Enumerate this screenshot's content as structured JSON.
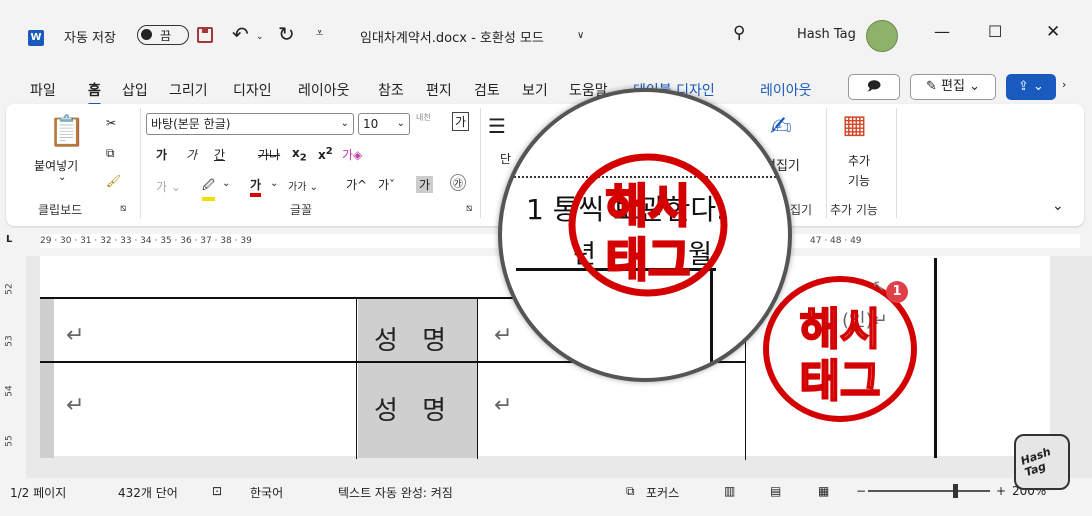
{
  "title_bar": {
    "autosave_label": "자동 저장",
    "toggle_state": "끔",
    "doc_title": "임대차계약서.docx - 호환성 모드",
    "user_name": "Hash Tag"
  },
  "menu": {
    "items": [
      "파일",
      "홈",
      "삽입",
      "그리기",
      "디자인",
      "레이아웃",
      "참조",
      "편지",
      "검토",
      "보기",
      "도움말",
      "테이블 디자인",
      "레이아웃"
    ],
    "active": "홈",
    "edit_label": "편집"
  },
  "ribbon": {
    "paste_label": "붙여넣기",
    "clipboard_group": "클립보드",
    "font_name": "바탕(본문 한글)",
    "font_size": "10",
    "font_group": "글꼴",
    "paragraph_label": "단",
    "editor_label": "편집기",
    "addins_label": "추가\n기능",
    "addins_line1": "추가",
    "addins_line2": "기능",
    "addins_group": "추가 기능",
    "editor_group": "집기",
    "format_row1": [
      "가",
      "가",
      "가",
      "가",
      "x₂",
      "x²"
    ],
    "bold": "가",
    "italic": "가",
    "underline": "간",
    "strike": "가",
    "sub": "x",
    "sup": "x"
  },
  "ruler": {
    "ticks": "29 · 30 · 31 · 32 · 33 · 34 · 35 · 36 · 37 · 38 · 39",
    "ticks_right": "47 · 48 · 49",
    "v_ticks": [
      "52",
      "53",
      "54",
      "55"
    ]
  },
  "document": {
    "row1_label": "성 명",
    "row2_label": "성 명",
    "magnified_text_line1": "1 통씩 보관한다.",
    "magnified_text_line2": "년 월 일",
    "stamp_text_top": "해시",
    "stamp_text_bottom": "태그",
    "badge_number": "1"
  },
  "status_bar": {
    "page": "1/2 페이지",
    "words": "432개 단어",
    "language": "한국어",
    "autocomplete": "텍스트 자동 완성: 켜짐",
    "focus": "포커스",
    "zoom": "200%"
  },
  "logo": {
    "text": "Hash Tag"
  },
  "colors": {
    "accent": "#185abd",
    "stamp": "#d40000",
    "badge": "#e0404a"
  }
}
